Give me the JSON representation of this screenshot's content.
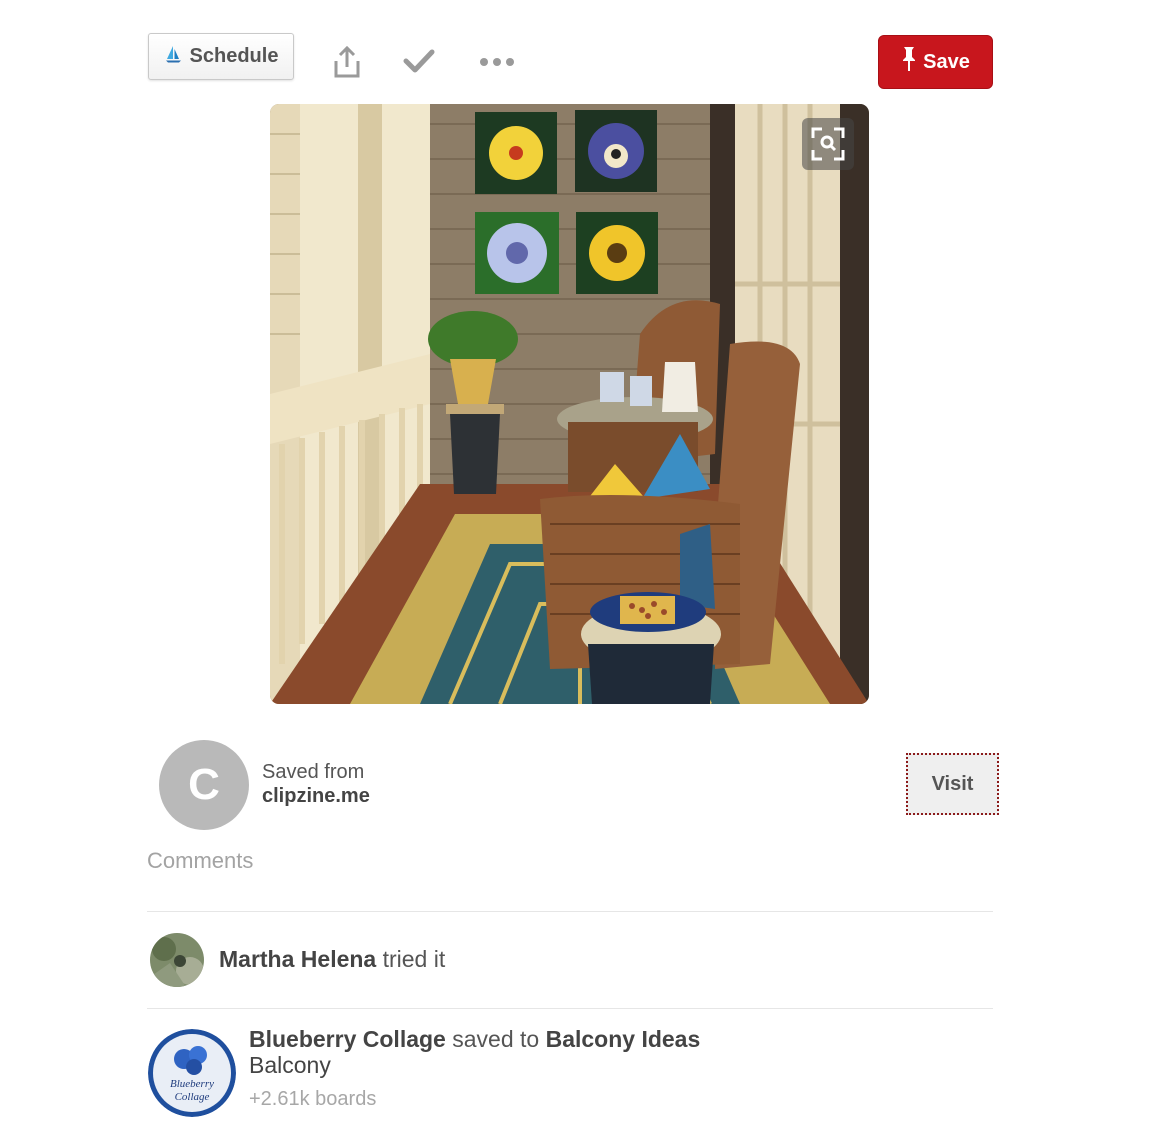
{
  "toolbar": {
    "schedule_label": "Schedule",
    "schedule_icon": "sailboat-icon",
    "share_icon": "share-icon",
    "tried_icon": "checkmark-icon",
    "more_icon": "more-options-icon",
    "save_label": "Save",
    "save_icon": "pushpin-icon",
    "save_color": "#c8161d"
  },
  "pin": {
    "image_subject": "photo",
    "lens_icon": "visual-search-icon"
  },
  "source": {
    "avatar_letter": "C",
    "saved_from_label": "Saved from",
    "domain": "clipzine.me",
    "visit_label": "Visit"
  },
  "comments": {
    "heading": "Comments"
  },
  "activity": [
    {
      "user": "Martha Helena",
      "action": "tried it"
    },
    {
      "user": "Blueberry Collage",
      "action": "saved to",
      "board": "Balcony Ideas",
      "description": "Balcony",
      "count": "+2.61k boards",
      "avatar_text_line1": "Blueberry",
      "avatar_text_line2": "Collage"
    }
  ]
}
